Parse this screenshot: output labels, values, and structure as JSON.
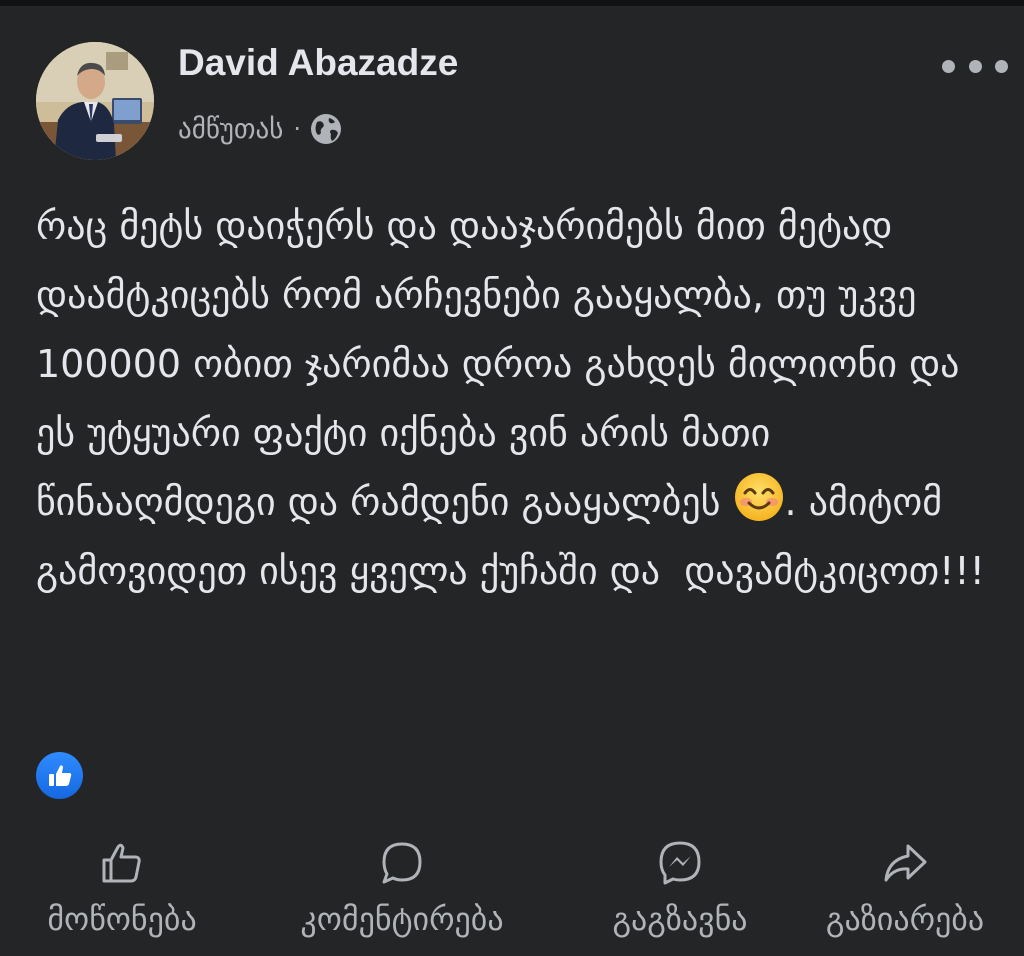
{
  "post": {
    "author": "David Abazadze",
    "timestamp": "ამწუთას",
    "separator": "·",
    "privacy_icon": "globe-icon",
    "text_before_emoji": "რაც მეტს დაიჭერს და დააჯარიმებს მით მეტად დაამტკიცებს რომ არჩევნები გააყალბა, თუ უკვე 100000 ობით ჯარიმაა დროა გახდეს მილიონი და ეს უტყუარი ფაქტი იქნება ვინ არის მათი წინააღმდეგი და რამდენი გააყალბეს ",
    "emoji": "smiling-face-emoji",
    "text_after_emoji": ". ამიტომ გამოვიდეთ ისევ ყველა ქუჩაში და  დავამტკიცოთ!!!",
    "reaction_icon": "like-reaction-icon"
  },
  "actions": [
    {
      "label": "მოწონება",
      "icon": "thumbs-up-icon"
    },
    {
      "label": "კომენტირება",
      "icon": "comment-icon"
    },
    {
      "label": "გაგზავნა",
      "icon": "messenger-icon"
    },
    {
      "label": "გაზიარება",
      "icon": "share-icon"
    }
  ],
  "colors": {
    "background": "#242526",
    "text": "#e4e6eb",
    "secondary_text": "#b0b3b8",
    "like_blue": "#1877f2"
  }
}
